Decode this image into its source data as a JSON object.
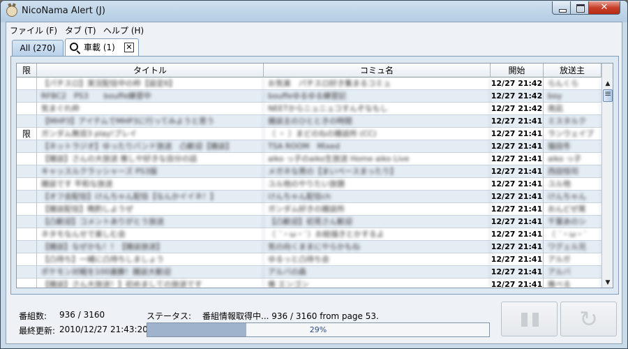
{
  "window": {
    "title": "NicoNama Alert (J)"
  },
  "menu": [
    "ファイル (F)",
    "タブ (T)",
    "ヘルプ (H)"
  ],
  "tabs": [
    {
      "label": "All (270)"
    },
    {
      "label": "車載 (1)",
      "close": "✕"
    }
  ],
  "table": {
    "columns": [
      "限",
      "タイトル",
      "コミュ名",
      "開始",
      "放送主"
    ],
    "rows": [
      {
        "lim": "",
        "title": "【パチスロ】実況配信中の枠【設定6】",
        "community": "お気楽　パチスロ好き集まるコミュ",
        "start": "12/27 21:42",
        "host": "らんくら"
      },
      {
        "lim": "",
        "title": "RFBC2　PS3　　bouffe練習中",
        "community": "bouffeゆるゆる練習記",
        "start": "12/27 21:42",
        "host": "boy"
      },
      {
        "lim": "",
        "title": "気まぐれ枠",
        "community": "NEETからニュニュコすんぞなもし",
        "start": "12/27 21:42",
        "host": "南凪"
      },
      {
        "lim": "",
        "title": "【MHP3】アイテムでMHP3に行ってみようと思う",
        "community": "雑談主のひとときの時間",
        "start": "12/27 21:41",
        "host": "ミスタルク"
      },
      {
        "lim": "限",
        "title": "ガンダム無双3 play!プレイ",
        "community": "（ ・ ）まどのねの雑談所 (CC)",
        "start": "12/27 21:41",
        "host": "ランウェイブ"
      },
      {
        "lim": "",
        "title": "【ネットラジオ】ゆったりバンド放送　凸歓迎【雑談】",
        "community": "TSA ROOM　Mixed",
        "start": "12/27 21:41",
        "host": "猫田冬"
      },
      {
        "lim": "",
        "title": "【雑談】さんの大放送 推しや好きな自分の話",
        "community": "aiko っ子のaiko生放送 Home aiko Live",
        "start": "12/27 21:41",
        "host": "aiko っ子"
      },
      {
        "lim": "",
        "title": "キャッスルクラッシャーズ PS3版",
        "community": "メガネな男の【まいペースまったり】",
        "start": "12/27 21:41",
        "host": "西田恒司"
      },
      {
        "lim": "",
        "title": "雑談です 平和な放送",
        "community": "ユル他のやりたい放題",
        "start": "12/27 21:41",
        "host": "ユル他"
      },
      {
        "lim": "",
        "title": "【オフ会配信】けんちゃん配信【なんかイイネ！】",
        "community": "けんちゃん配信ch",
        "start": "12/27 21:41",
        "host": "けんちゃん"
      },
      {
        "lim": "",
        "title": "【雑談配信】晩酌しようぜ",
        "community": "ガンダム好きの雑談所",
        "start": "12/27 21:41",
        "host": "おんどぜ尾"
      },
      {
        "lim": "",
        "title": "【凸歓迎】コメントありがとう放送",
        "community": "【凸歓迎】初見さん歓迎",
        "start": "12/27 21:41",
        "host": "千葉あのシ"
      },
      {
        "lim": "",
        "title": "ネタモなんせで楽しむ会",
        "community": "（ ´・ω・`）お絵描きとかするよ",
        "start": "12/27 21:41",
        "host": "（ ´・ω・`"
      },
      {
        "lim": "",
        "title": "【雑談】なぜかも！！【雑談放送】",
        "community": "気の向くままにやらかもね",
        "start": "12/27 21:41",
        "host": "ワグェル兄"
      },
      {
        "lim": "",
        "title": "【凸待ち】一緒に凸待ちしましょう",
        "community": "ゆるっと凸待ち会",
        "start": "12/27 21:41",
        "host": "アルガ"
      },
      {
        "lim": "",
        "title": "ポケモン対戦を100連勝！雑談大歓迎",
        "community": "アルバの森",
        "start": "12/27 21:41",
        "host": "アルバ"
      },
      {
        "lim": "",
        "title": "【雑談】さん大放送！】初めましての放送です",
        "community": "推 エンゴン",
        "start": "12/27 21:41",
        "host": "推べる"
      }
    ]
  },
  "status": {
    "count_label": "番組数:",
    "count_value": "936 / 3160",
    "updated_label": "最終更新:",
    "updated_value": "2010/12/27 21:43:20",
    "status_label": "ステータス:",
    "status_value": "番組情報取得中... 936 / 3160 from page 53.",
    "progress": 0.29,
    "progress_text": "29%"
  },
  "icons": {
    "app": "niconama-icon",
    "pause": "pause-icon",
    "reload": "reload-icon",
    "search": "search-icon"
  }
}
